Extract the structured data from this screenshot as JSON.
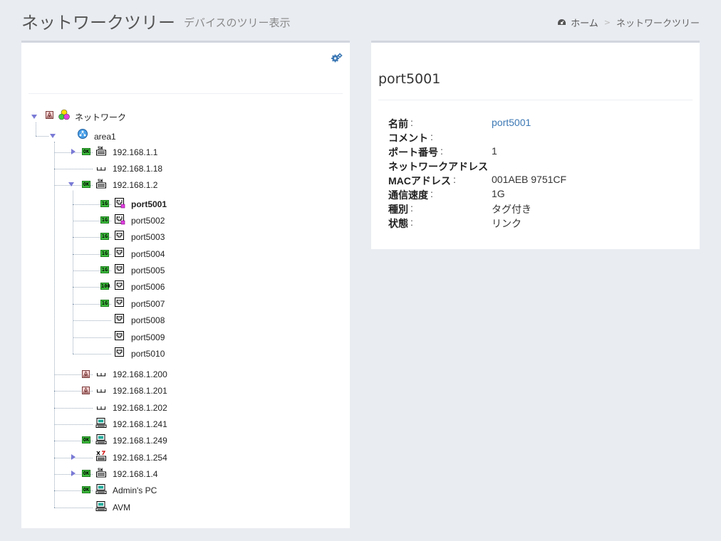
{
  "header": {
    "title": "ネットワークツリー",
    "subtitle": "デバイスのツリー表示"
  },
  "breadcrumb": {
    "home": "ホーム",
    "separator": ">",
    "current": "ネットワークツリー"
  },
  "tree": {
    "root": {
      "label": "ネットワーク"
    },
    "area": {
      "label": "area1"
    },
    "devices": [
      {
        "label": "192.168.1.1",
        "status": "OK",
        "icon": "switch-icon",
        "expandable": true
      },
      {
        "label": "192.168.1.18",
        "status": "",
        "icon": "hub-icon",
        "expandable": false
      },
      {
        "label": "192.168.1.2",
        "status": "OK",
        "icon": "switch-icon",
        "expandable": true,
        "expanded": true
      },
      {
        "label": "192.168.1.200",
        "status": "warn",
        "icon": "hub-icon",
        "expandable": false
      },
      {
        "label": "192.168.1.201",
        "status": "warn",
        "icon": "hub-icon",
        "expandable": false
      },
      {
        "label": "192.168.1.202",
        "status": "",
        "icon": "hub-icon",
        "expandable": false
      },
      {
        "label": "192.168.1.241",
        "status": "",
        "icon": "pc-icon",
        "expandable": false
      },
      {
        "label": "192.168.1.249",
        "status": "OK",
        "icon": "pc-icon",
        "expandable": false
      },
      {
        "label": "192.168.1.254",
        "status": "",
        "icon": "router-icon",
        "expandable": true
      },
      {
        "label": "192.168.1.4",
        "status": "OK",
        "icon": "switch-icon",
        "expandable": true
      },
      {
        "label": "Admin's PC",
        "status": "OK",
        "icon": "pc-icon",
        "expandable": false
      },
      {
        "label": "AVM",
        "status": "",
        "icon": "pc-icon",
        "expandable": false
      }
    ],
    "ports": [
      {
        "label": "port5001",
        "speed": "1G",
        "selected": true
      },
      {
        "label": "port5002",
        "speed": "1G"
      },
      {
        "label": "port5003",
        "speed": "1G"
      },
      {
        "label": "port5004",
        "speed": "1G"
      },
      {
        "label": "port5005",
        "speed": "1G"
      },
      {
        "label": "port5006",
        "speed": "100"
      },
      {
        "label": "port5007",
        "speed": "1G"
      },
      {
        "label": "port5008",
        "speed": ""
      },
      {
        "label": "port5009",
        "speed": ""
      },
      {
        "label": "port5010",
        "speed": ""
      }
    ]
  },
  "detail": {
    "title": "port5001",
    "props": [
      {
        "key": "名前",
        "value": "port5001",
        "link": true
      },
      {
        "key": "コメント",
        "value": ""
      },
      {
        "key": "ポート番号",
        "value": "1"
      },
      {
        "key": "ネットワークアドレス",
        "value": ""
      },
      {
        "key": "MACアドレス",
        "value": "001AEB 9751CF"
      },
      {
        "key": "通信速度",
        "value": "1G"
      },
      {
        "key": "種別",
        "value": "タグ付き"
      },
      {
        "key": "状態",
        "value": "リンク"
      }
    ],
    "colon": ":"
  },
  "colors": {
    "ok_green": "#3fbf3f",
    "link_blue": "#3c78b4",
    "toggle_purple": "#7a7ad6"
  }
}
